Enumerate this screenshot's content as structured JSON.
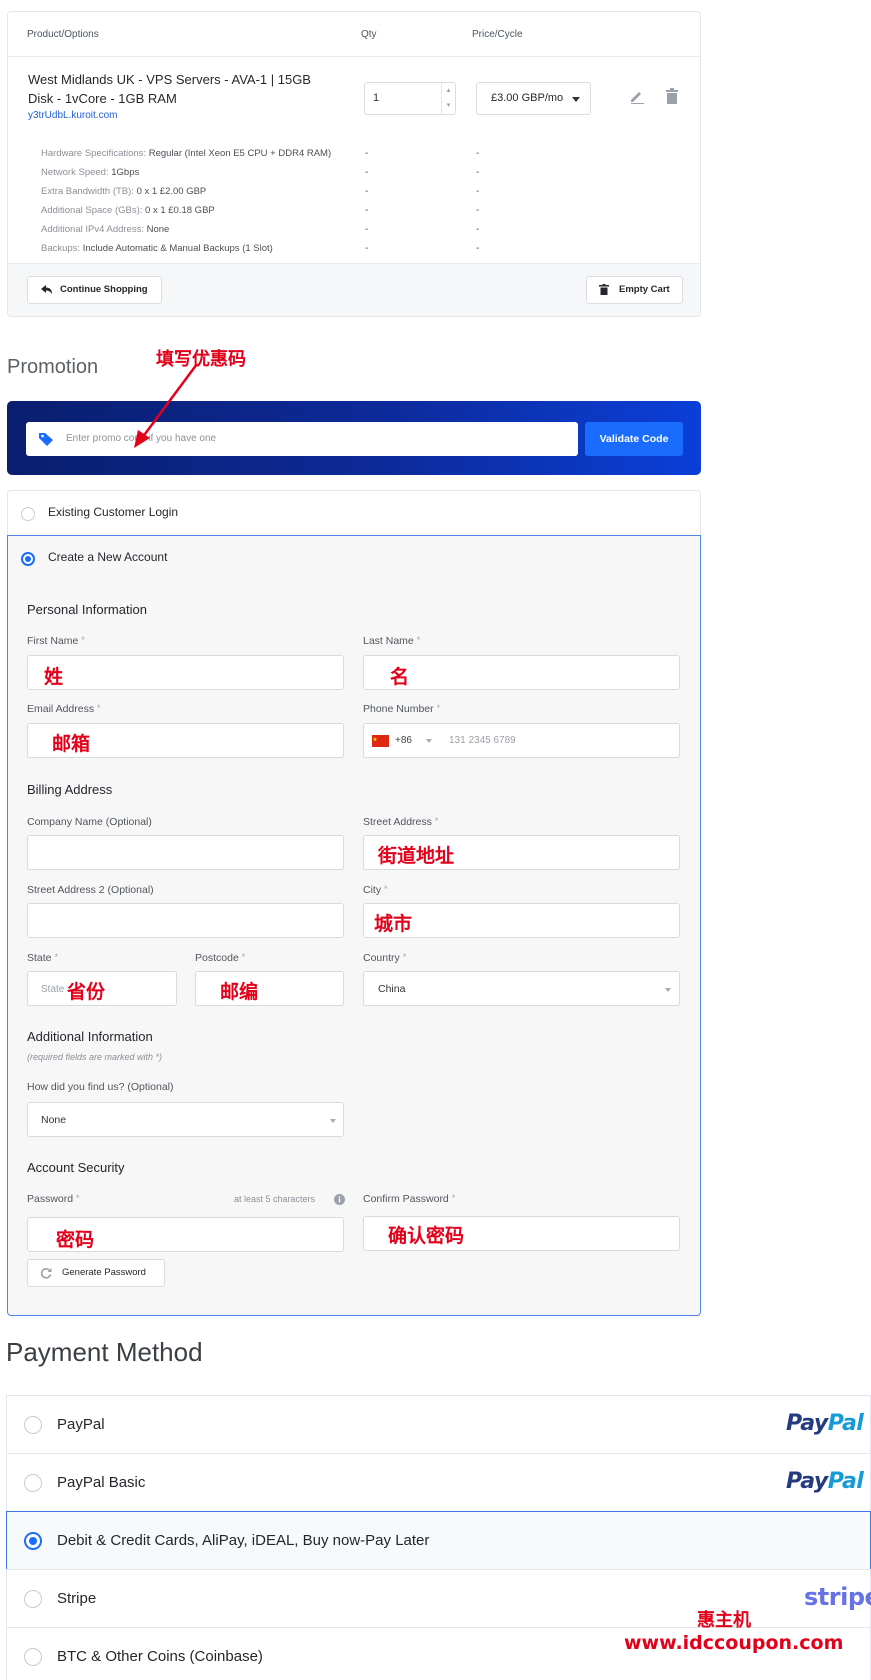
{
  "cart": {
    "headers": {
      "product": "Product/Options",
      "qty": "Qty",
      "price": "Price/Cycle"
    },
    "item": {
      "title": "West Midlands UK - VPS Servers - AVA-1 | 15GB Disk - 1vCore - 1GB RAM",
      "domain": "y3trUdbL.kuroit.com",
      "qty": "1",
      "price": "£3.00 GBP/mo",
      "options": [
        {
          "label": "Hardware Specifications:",
          "value": "Regular (Intel Xeon E5 CPU + DDR4 RAM)",
          "qty": "-",
          "price": "-"
        },
        {
          "label": "Network Speed:",
          "value": "1Gbps",
          "qty": "-",
          "price": "-"
        },
        {
          "label": "Extra Bandwidth (TB):",
          "value": "0 x 1 £2.00 GBP",
          "qty": "-",
          "price": "-"
        },
        {
          "label": "Additional Space (GBs):",
          "value": "0 x 1 £0.18 GBP",
          "qty": "-",
          "price": "-"
        },
        {
          "label": "Additional IPv4 Address:",
          "value": "None",
          "qty": "-",
          "price": "-"
        },
        {
          "label": "Backups:",
          "value": "Include Automatic & Manual Backups (1 Slot)",
          "qty": "-",
          "price": "-"
        }
      ]
    },
    "continue_label": "Continue Shopping",
    "empty_label": "Empty Cart"
  },
  "promotion": {
    "heading": "Promotion",
    "annotation": "填写优惠码",
    "placeholder": "Enter promo code if you have one",
    "validate_label": "Validate Code"
  },
  "account": {
    "existing_label": "Existing Customer Login",
    "create_label": "Create a New Account",
    "personal_title": "Personal Information",
    "first_name": {
      "label": "First Name",
      "fill": "姓"
    },
    "last_name": {
      "label": "Last Name",
      "fill": "名"
    },
    "email": {
      "label": "Email Address",
      "fill": "邮箱"
    },
    "phone": {
      "label": "Phone Number",
      "code": "+86",
      "placeholder": "131 2345 6789"
    },
    "billing_title": "Billing Address",
    "company": {
      "label": "Company Name (Optional)"
    },
    "street": {
      "label": "Street Address",
      "fill": "街道地址"
    },
    "street2": {
      "label": "Street Address 2 (Optional)"
    },
    "city": {
      "label": "City",
      "fill": "城市"
    },
    "state": {
      "label": "State",
      "placeholder": "State",
      "fill": "省份"
    },
    "postcode": {
      "label": "Postcode",
      "fill": "邮编"
    },
    "country": {
      "label": "Country",
      "value": "China"
    },
    "additional_title": "Additional Information",
    "required_note": "(required fields are marked with *)",
    "findus": {
      "label": "How did you find us? (Optional)",
      "value": "None"
    },
    "security_title": "Account Security",
    "password": {
      "label": "Password",
      "hint": "at least 5 characters",
      "fill": "密码"
    },
    "confirm": {
      "label": "Confirm Password",
      "fill": "确认密码"
    },
    "generate_label": "Generate Password",
    "required_mark": "*"
  },
  "payment": {
    "heading": "Payment Method",
    "methods": [
      {
        "label": "PayPal",
        "logo": "PayPal"
      },
      {
        "label": "PayPal Basic",
        "logo": "PayPal"
      },
      {
        "label": "Debit & Credit Cards, AliPay, iDEAL, Buy now-Pay Later",
        "logo": ""
      },
      {
        "label": "Stripe",
        "logo": "stripe"
      },
      {
        "label": "BTC & Other Coins (Coinbase)",
        "logo": ""
      }
    ],
    "paypal_logo": {
      "part1": "Pay",
      "part2": "Pal"
    },
    "stripe_logo": "stripe"
  },
  "watermark": {
    "line1": "惠主机",
    "line2": "www.idccoupon.com"
  },
  "colors": {
    "accent": "#1a6cff",
    "annotation": "#e2001a",
    "promo_gradient_start": "#0a1e6e",
    "promo_gradient_end": "#0b3fd8"
  },
  "icons": {
    "tag": "tag-icon",
    "edit": "pencil-icon",
    "delete": "trash-icon",
    "back": "arrow-back-icon",
    "info": "info-icon",
    "refresh": "refresh-icon",
    "flag": "china-flag-icon"
  }
}
